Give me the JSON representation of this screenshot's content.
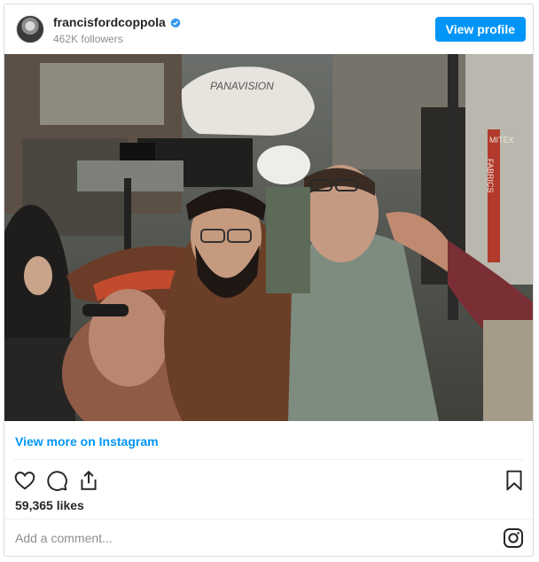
{
  "header": {
    "username": "francisfordcoppola",
    "followers": "462K followers",
    "view_profile_label": "View profile",
    "avatar_icon": "profile-avatar",
    "verified_icon": "verified-badge-icon"
  },
  "photo": {
    "camera_brand": "PANAVISION",
    "sign_text": "FABRICS",
    "sign_top": "MITEX"
  },
  "links": {
    "view_more": "View more on Instagram"
  },
  "actions": {
    "icons": [
      "heart-icon",
      "comment-icon",
      "share-icon",
      "bookmark-icon"
    ]
  },
  "likes": "59,365 likes",
  "comment": {
    "placeholder": "Add a comment...",
    "icon": "instagram-icon"
  },
  "colors": {
    "accent": "#0095f6",
    "muted": "#8e8e8e",
    "border": "#dbdbdb"
  }
}
